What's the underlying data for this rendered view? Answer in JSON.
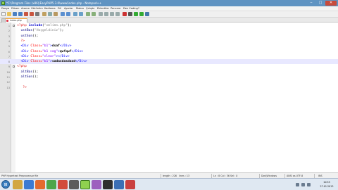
{
  "window": {
    "title": "*C:\\Program Files (x86)\\EasyPHP5.3.0\\www\\index.php - Notepad++",
    "minimize": "‒",
    "maximize": "□",
    "close": "✕"
  },
  "menu": [
    "Dosya",
    "Düzen",
    "Arama",
    "Görünüm",
    "Kodlama",
    "Dil",
    "Ayarlar",
    "Makro",
    "Çalıştır",
    "Eklentiler",
    "Pencere",
    "Dev Coding",
    "?"
  ],
  "tab": {
    "label": "index.php"
  },
  "editor": {
    "lines": [
      {
        "n": "1",
        "parts": [
          [
            "c-php",
            "<?php "
          ],
          [
            "c-kw",
            "include"
          ],
          [
            "c-br",
            "("
          ],
          [
            "c-str",
            "\"xmlimn.php\""
          ],
          [
            "c-br",
            ");"
          ]
        ]
      },
      {
        "n": "2",
        "parts": [
          [
            "c-fn",
            "  ustBas"
          ],
          [
            "c-br",
            "("
          ],
          [
            "c-str",
            "\"Hoşgeldiniz\""
          ],
          [
            "c-br",
            ");"
          ]
        ]
      },
      {
        "n": "3",
        "parts": [
          [
            "c-fn",
            "  ustSon"
          ],
          [
            "c-br",
            "();"
          ]
        ]
      },
      {
        "n": "4",
        "parts": [
          [
            "c-php",
            "  ?>"
          ]
        ]
      },
      {
        "n": "5",
        "parts": [
          [
            "c-tag",
            "  <Div "
          ],
          [
            "c-attr",
            "Class="
          ],
          [
            "c-val",
            "\"b1\""
          ],
          [
            "c-tag",
            ">"
          ],
          [
            "c-txt",
            "dsaf"
          ],
          [
            "c-tag",
            "</Div>"
          ]
        ]
      },
      {
        "n": "6",
        "parts": [
          [
            "c-tag",
            "  <Div "
          ],
          [
            "c-attr",
            "Class="
          ],
          [
            "c-val",
            "\"b1 sag\""
          ],
          [
            "c-tag",
            ">"
          ],
          [
            "c-txt",
            "qwfqwf"
          ],
          [
            "c-tag",
            "</Div>"
          ]
        ]
      },
      {
        "n": "7",
        "parts": [
          [
            "c-tag",
            "  <Div "
          ],
          [
            "c-attr",
            "Class="
          ],
          [
            "c-val",
            "\"clear\""
          ],
          [
            "c-tag",
            "></Div>"
          ]
        ]
      },
      {
        "n": "8",
        "parts": [
          [
            "c-tag",
            "  <Div "
          ],
          [
            "c-attr",
            "Class="
          ],
          [
            "c-val",
            "\"b1\""
          ],
          [
            "c-tag",
            ">"
          ],
          [
            "c-txt",
            "sadasdasdasd"
          ],
          [
            "c-tag",
            "</Div>"
          ]
        ]
      },
      {
        "n": "9",
        "parts": [
          [
            "c-php",
            "<?php"
          ]
        ]
      },
      {
        "n": "10",
        "parts": [
          [
            "c-fn",
            "  altBas"
          ],
          [
            "c-br",
            "();"
          ]
        ]
      },
      {
        "n": "11",
        "parts": [
          [
            "c-fn",
            "  altSon"
          ],
          [
            "c-br",
            "();"
          ]
        ]
      },
      {
        "n": "12",
        "parts": []
      },
      {
        "n": "13",
        "parts": [
          [
            "c-php",
            "   ?>"
          ]
        ]
      }
    ],
    "current_line": "8"
  },
  "status": {
    "file_type": "PHP Hypertext Preprocessor file",
    "length": "length : 226",
    "lines": "lines : 13",
    "position": "Ln : 8    Col : 36    Sel : 0",
    "eol": "Dos\\Windows",
    "encoding": "ANSI as UTF-8",
    "mode": "INS"
  },
  "taskbar": {
    "time": "10:55",
    "date": "27.01.2013"
  }
}
